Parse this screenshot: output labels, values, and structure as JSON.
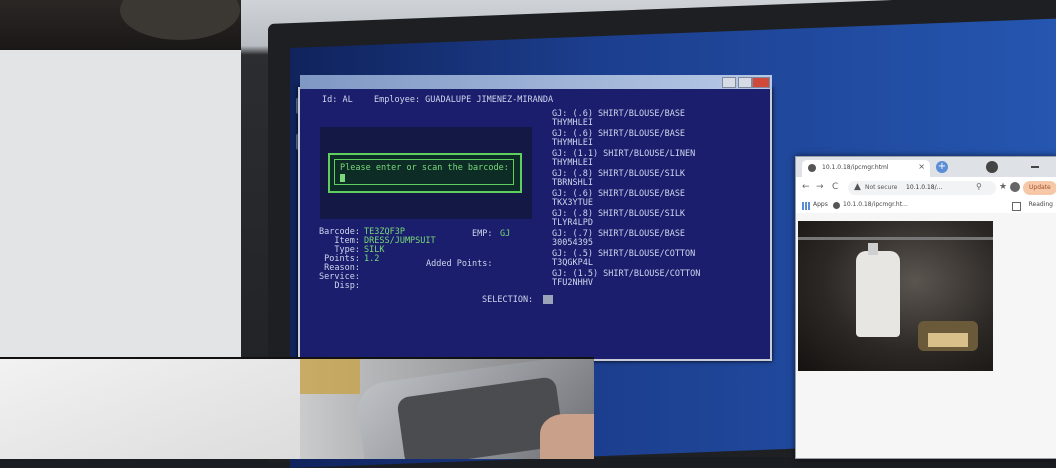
{
  "terminal": {
    "header_id": "Id: AL",
    "header_employee": "Employee: GUADALUPE JIMENEZ-MIRANDA",
    "prompt": "Please enter or scan the barcode:",
    "fields": [
      {
        "label": "Barcode:",
        "value": "TE3ZQF3P"
      },
      {
        "label": "Item:",
        "value": "DRESS/JUMPSUIT"
      },
      {
        "label": "Type:",
        "value": "SILK"
      },
      {
        "label": "Points:",
        "value": "1.2"
      },
      {
        "label": "Reason:",
        "value": ""
      },
      {
        "label": "Service:",
        "value": ""
      },
      {
        "label": "Disp:",
        "value": ""
      }
    ],
    "emp_label": "EMP:",
    "emp_value": "GJ",
    "added_points_label": "Added Points:",
    "selection_label": "SELECTION:",
    "log": [
      {
        "line": "GJ: (.6) SHIRT/BLOUSE/BASE",
        "code": "THYMHLEI"
      },
      {
        "line": "GJ: (.6) SHIRT/BLOUSE/BASE",
        "code": "THYMHLEI"
      },
      {
        "line": "GJ: (1.1) SHIRT/BLOUSE/LINEN",
        "code": "THYMHLEI"
      },
      {
        "line": "GJ: (.8) SHIRT/BLOUSE/SILK",
        "code": "TBRNSHLI"
      },
      {
        "line": "GJ: (.6) SHIRT/BLOUSE/BASE",
        "code": "TKX3YTUE"
      },
      {
        "line": "GJ: (.8) SHIRT/BLOUSE/SILK",
        "code": "TLYR4LPD"
      },
      {
        "line": "GJ: (.7) SHIRT/BLOUSE/BASE",
        "code": "30054395"
      },
      {
        "line": "GJ: (.5) SHIRT/BLOUSE/COTTON",
        "code": "T3QGKP4L"
      },
      {
        "line": "GJ: (1.5) SHIRT/BLOUSE/COTTON",
        "code": "TFU2NHHV"
      }
    ]
  },
  "browser": {
    "tab_title": "10.1.0.18/ipcmgr.html",
    "tab_close": "×",
    "new_tab": "+",
    "back": "←",
    "forward": "→",
    "reload": "C",
    "warning": "▲",
    "not_secure": "Not secure",
    "url": "10.1.0.18/...",
    "update": "Update",
    "apps": "Apps",
    "bookmark": "10.1.0.18/ipcmgr.ht...",
    "reading_list": "Reading"
  },
  "colors": {
    "terminal_bg": "#1a1e6c",
    "terminal_text": "#cfd6ee",
    "terminal_green": "#7ad97a",
    "desktop_blue": "#1c3e8e"
  }
}
